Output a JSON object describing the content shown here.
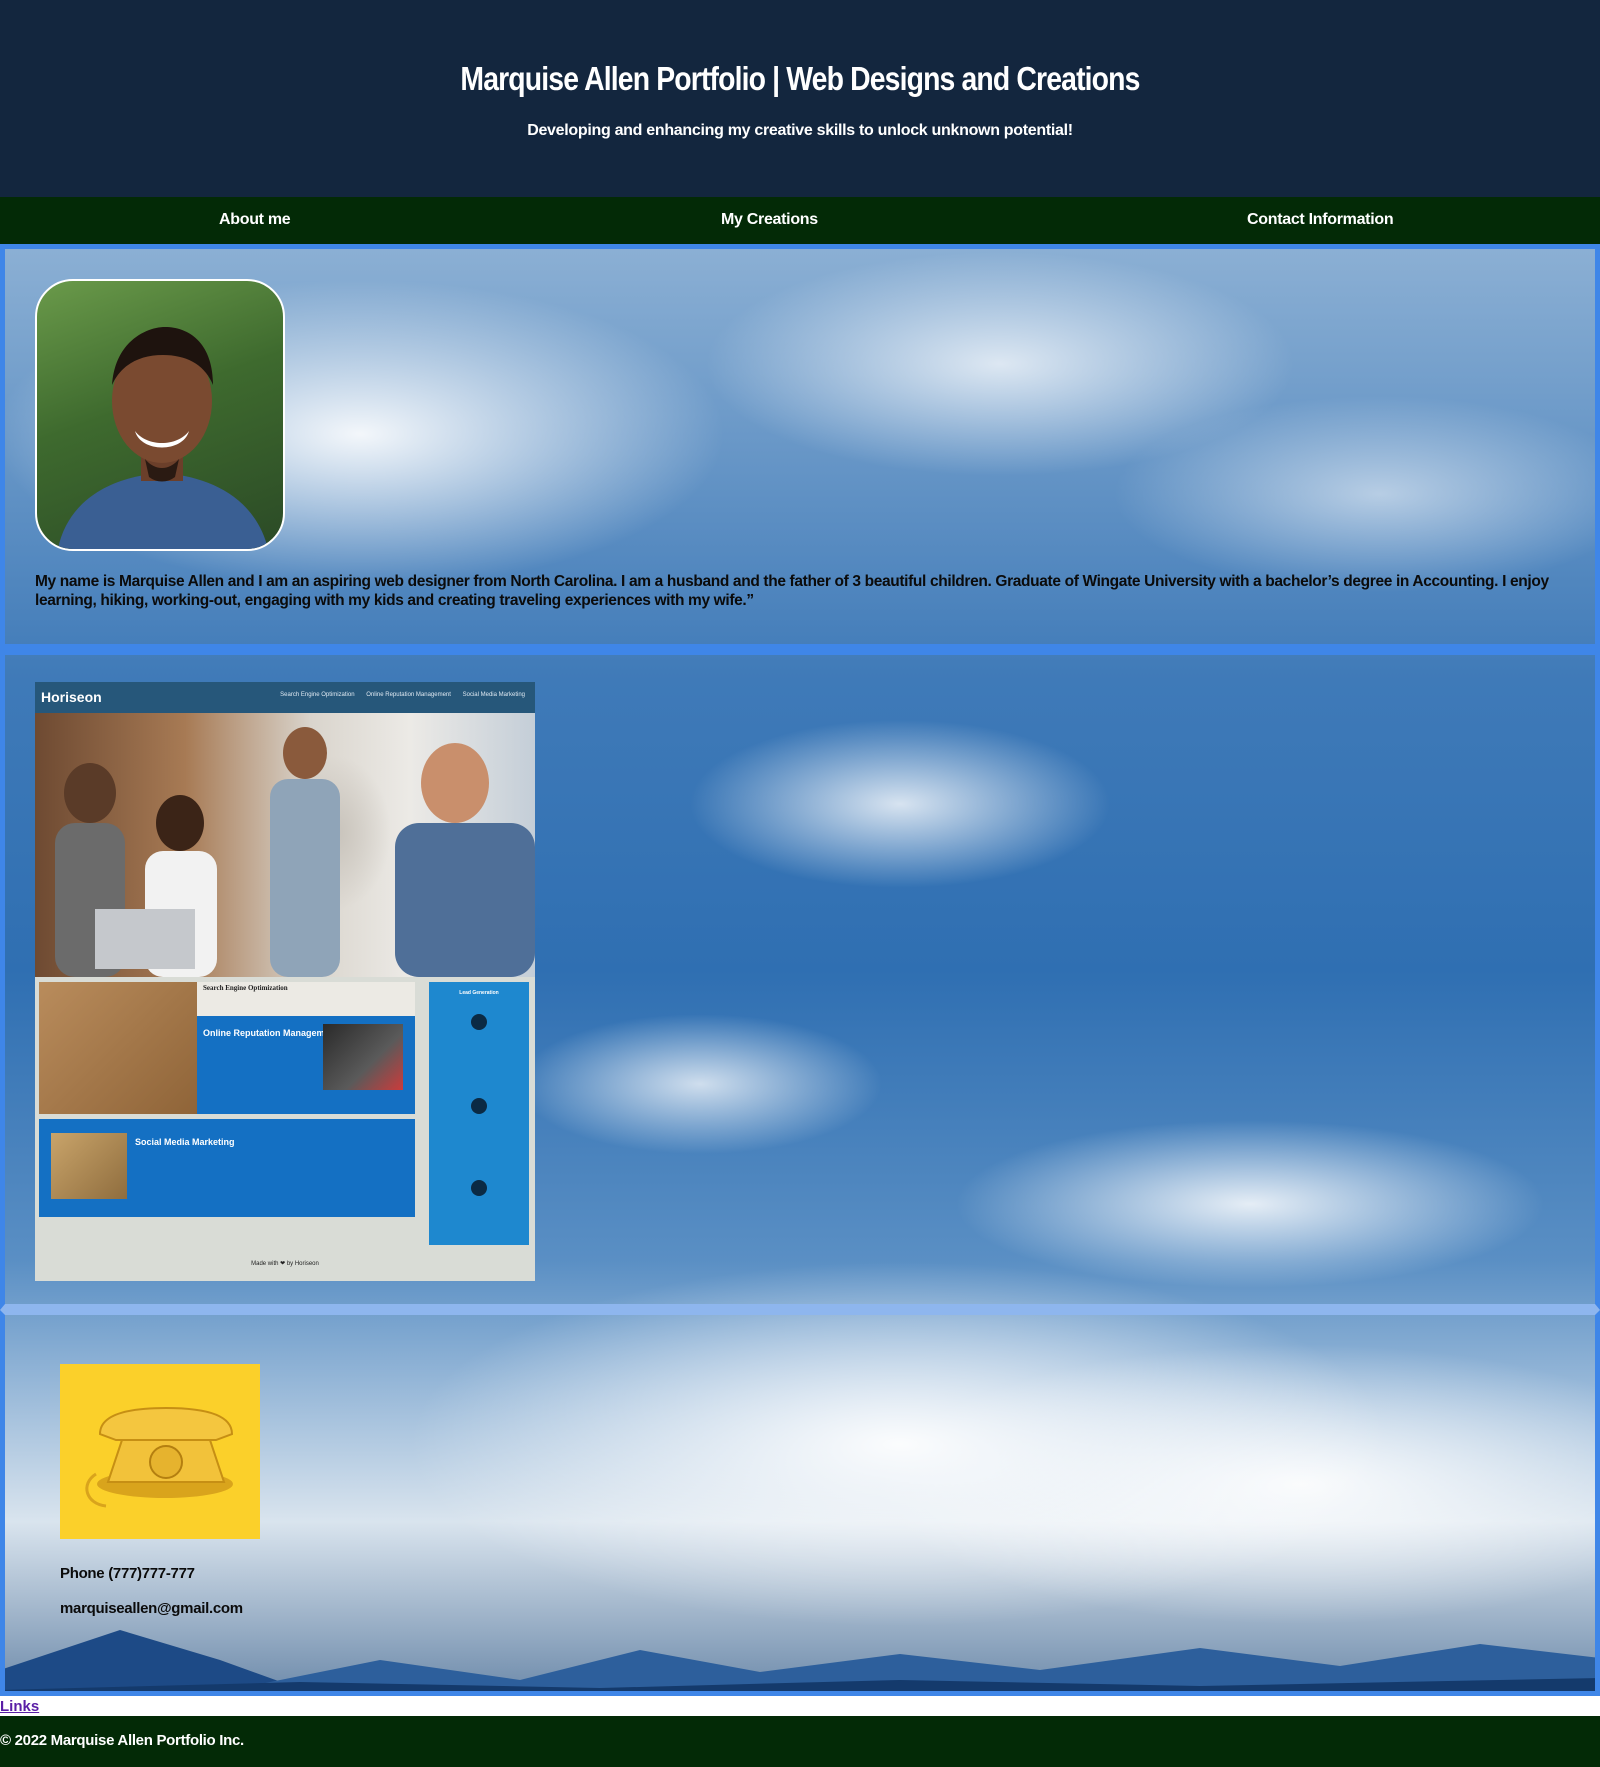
{
  "header": {
    "title": "Marquise Allen Portfolio | Web Designs and Creations",
    "tagline": "Developing and enhancing my creative skills to unlock unknown potential!"
  },
  "nav": {
    "about": "About me",
    "creations": "My Creations",
    "contact": "Contact Information"
  },
  "about": {
    "bio": "My name is Marquise Allen and I am an aspiring web designer from North Carolina. I am a husband and the father of 3 beautiful children. Graduate of Wingate University with a bachelor’s degree in Accounting. I enjoy learning, hiking, working-out, engaging with my kids and creating traveling experiences with my wife.”"
  },
  "creations": {
    "project": {
      "logo": "Horiseon",
      "links": [
        "Search Engine Optimization",
        "Online Reputation Management",
        "Social Media Marketing"
      ],
      "seo_title": "Search Engine Optimization",
      "orm_title": "Online Reputation Management",
      "smm_title": "Social Media Marketing",
      "side_title": "Lead Generation",
      "footer": "Made with ❤ by Horiseon"
    }
  },
  "contact": {
    "phone": "Phone (777)777-777",
    "email": "marquiseallen@gmail.com"
  },
  "links": {
    "label": "Links"
  },
  "footer": {
    "copyright": "© 2022 Marquise Allen Portfolio Inc."
  },
  "colors": {
    "header_bg": "#13263e",
    "nav_bg": "#032a06",
    "section_border": "#3f86e8",
    "link_color": "#5a1ea6"
  }
}
